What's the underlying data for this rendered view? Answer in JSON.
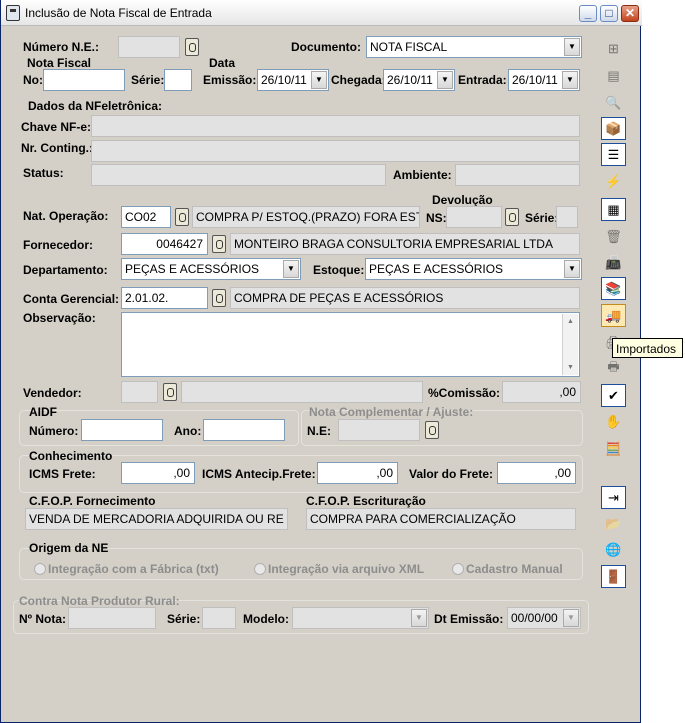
{
  "window": {
    "title": "Inclusão de Nota Fiscal de Entrada",
    "minimize": "_",
    "maximize": "□",
    "close": "✕"
  },
  "labels": {
    "numero_ne": "Número N.E.:",
    "documento": "Documento:",
    "nota_fiscal": "Nota Fiscal",
    "data": "Data",
    "no": "No:",
    "serie": "Série:",
    "emissao": "Emissão:",
    "chegada": "Chegada:",
    "entrada": "Entrada:",
    "dados_nfe": "Dados da NFeletrônica:",
    "chave": "Chave NF-e:",
    "nr_conting": "Nr. Conting.:",
    "status": "Status:",
    "ambiente": "Ambiente:",
    "devolucao": "Devolução",
    "nat_operacao": "Nat. Operação:",
    "ns": "NS:",
    "serie2": "Série:",
    "fornecedor": "Fornecedor:",
    "departamento": "Departamento:",
    "estoque": "Estoque:",
    "conta_gerencial": "Conta Gerencial:",
    "observacao": "Observação:",
    "vendedor": "Vendedor:",
    "comissao": "%Comissão:",
    "aidf": "AIDF",
    "numero": "Número:",
    "ano": "Ano:",
    "nota_compl": "Nota Complementar / Ajuste:",
    "ne": "N.E:",
    "conhecimento": "Conhecimento",
    "icms_frete": "ICMS Frete:",
    "icms_antecip": "ICMS Antecip.Frete:",
    "valor_frete": "Valor do Frete:",
    "cfop_fornec": "C.F.O.P. Fornecimento",
    "cfop_escrit": "C.F.O.P. Escrituração",
    "origem": "Origem da NE",
    "contra_nota": "Contra Nota Produtor Rural:",
    "n_nota": "Nº Nota:",
    "serie3": "Série:",
    "modelo": "Modelo:",
    "dt_emissao": "Dt Emissão:"
  },
  "values": {
    "documento": "NOTA FISCAL",
    "emissao": "26/10/11",
    "chegada": "26/10/11",
    "entrada": "26/10/11",
    "nat_operacao_code": "CO02",
    "nat_operacao_desc": "COMPRA P/ ESTOQ.(PRAZO) FORA ESTA",
    "fornecedor_code": "0046427",
    "fornecedor_nome": "MONTEIRO BRAGA CONSULTORIA EMPRESARIAL LTDA",
    "departamento": "PEÇAS E ACESSÓRIOS",
    "estoque": "PEÇAS E ACESSÓRIOS",
    "conta_code": "2.01.02.",
    "conta_desc": "COMPRA DE PEÇAS E ACESSÓRIOS",
    "comissao": ",00",
    "icms_frete": ",00",
    "icms_antecip": ",00",
    "valor_frete": ",00",
    "cfop_fornec": "VENDA DE MERCADORIA ADQUIRIDA OU RE",
    "cfop_escrit": "COMPRA PARA COMERCIALIZAÇÃO",
    "dt_emissao": "00/00/00"
  },
  "origem_options": [
    "Integração com a Fábrica (txt)",
    "Integração via arquivo XML",
    "Cadastro Manual"
  ],
  "toolbar": {
    "icons": [
      "insert-row-icon",
      "edit-table-icon",
      "preview-icon",
      "open-box-icon",
      "list-icon",
      "lightning-icon",
      "stack-icon",
      "trash-icon",
      "scanner-icon",
      "books-icon",
      "truck-icon",
      "printer-icon",
      "print-icon",
      "check-icon",
      "hand-icon",
      "calculator-icon",
      "grid-arrow-icon",
      "folder-icon",
      "globe-icon",
      "exit-icon"
    ],
    "tooltip": "Importados"
  }
}
